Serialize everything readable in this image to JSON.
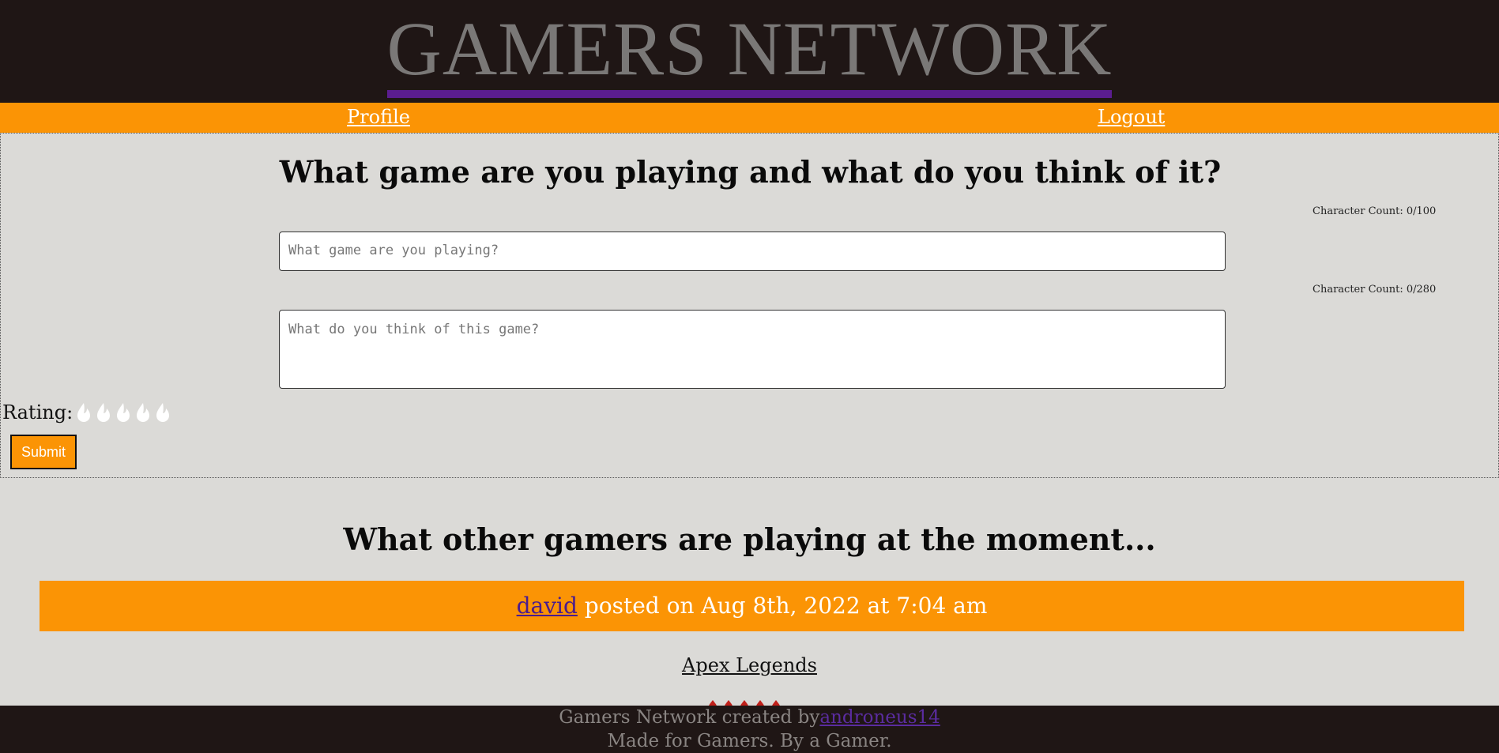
{
  "site": {
    "title": "GAMERS NETWORK",
    "colors": {
      "header_bg": "#1f1615",
      "accent": "#fb9405",
      "title_underline": "#5b1d8f",
      "page_bg": "#dbdad7"
    }
  },
  "nav": {
    "profile_label": "Profile",
    "logout_label": "Logout"
  },
  "form": {
    "heading": "What game are you playing and what do you think of it?",
    "game_count": "Character Count: 0/100",
    "game_placeholder": "What game are you playing?",
    "game_value": "",
    "review_count": "Character Count: 0/280",
    "review_placeholder": "What do you think of this game?",
    "review_value": "",
    "rating_label": "Rating:",
    "rating_icon": "flame-icon",
    "rating_value": 0,
    "rating_max": 5,
    "submit_label": "Submit"
  },
  "feed": {
    "heading": "What other gamers are playing at the moment...",
    "posts": [
      {
        "author": "david",
        "posted_text": " posted on Aug 8th, 2022 at 7:04 am",
        "game": "Apex Legends",
        "rating_icon": "flame-icon",
        "rating_color": "#c0201a"
      }
    ]
  },
  "footer": {
    "created_by_text": "Gamers Network created by",
    "author_link": "androneus14",
    "tagline": "Made for Gamers. By a Gamer."
  }
}
